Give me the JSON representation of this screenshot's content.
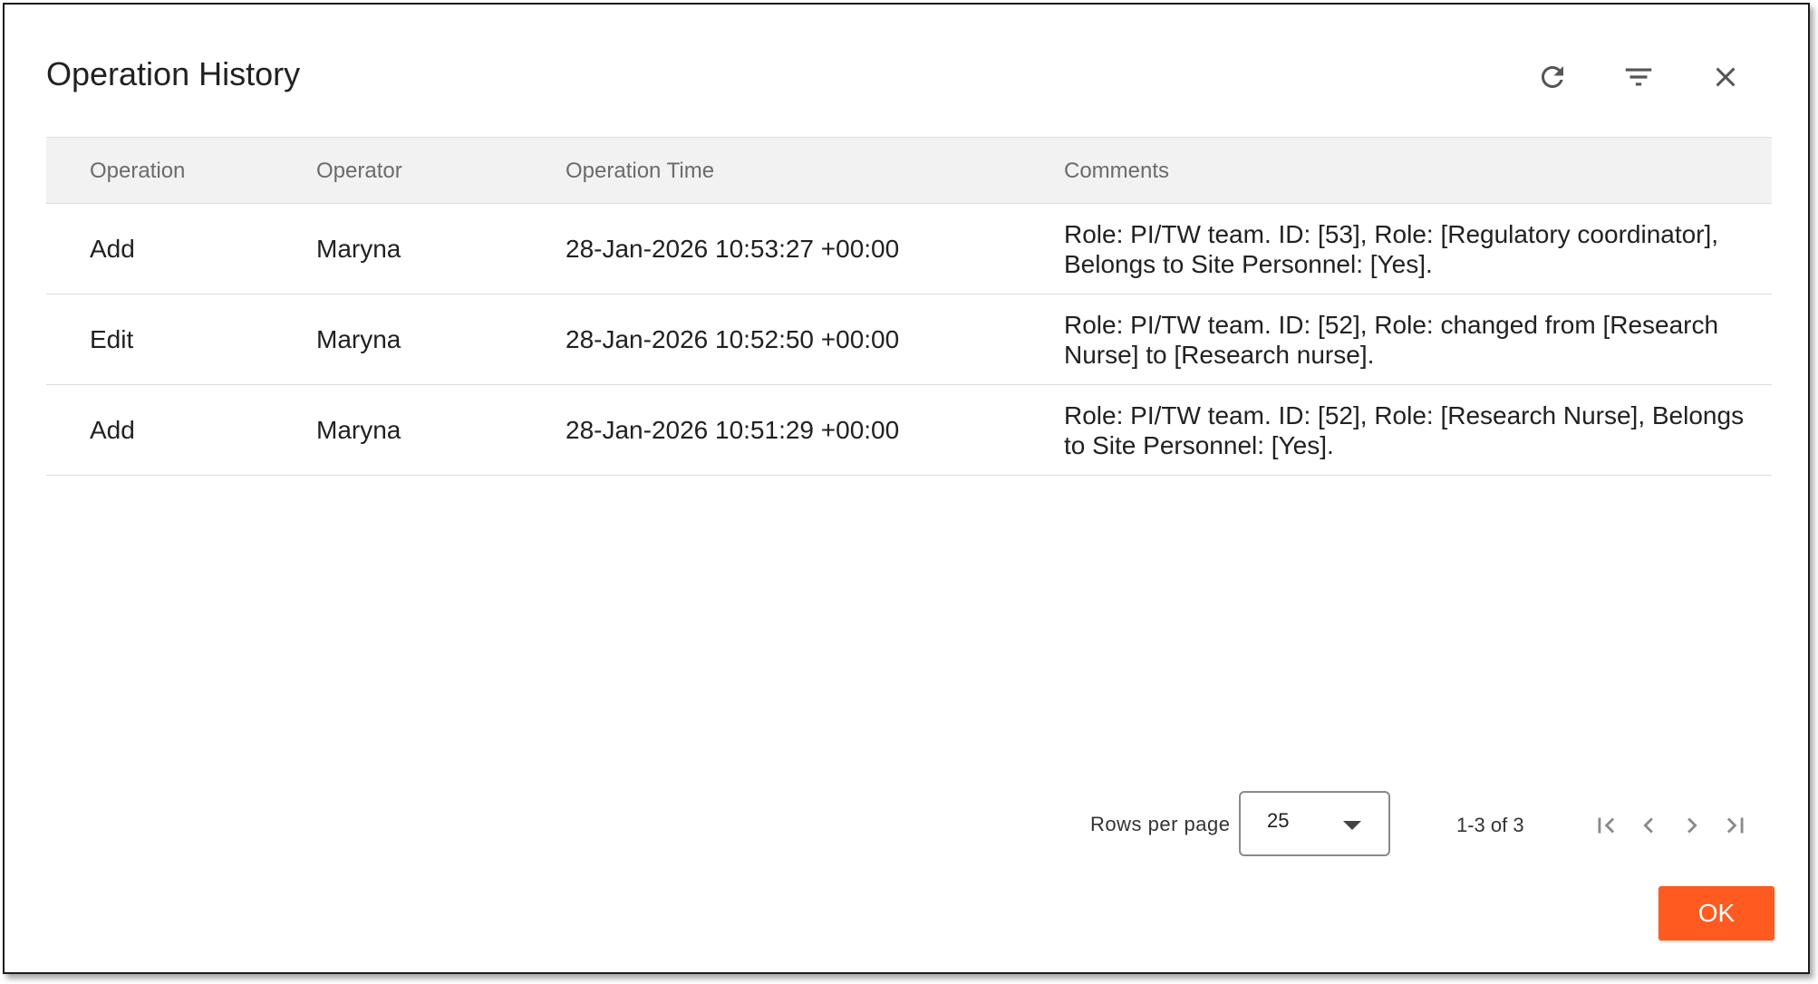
{
  "dialog": {
    "title": "Operation History",
    "icons": {
      "refresh": "refresh-icon",
      "filter": "filter-icon",
      "close": "close-icon"
    }
  },
  "table": {
    "columns": [
      "Operation",
      "Operator",
      "Operation Time",
      "Comments"
    ],
    "rows": [
      {
        "operation": "Add",
        "operator": "Maryna",
        "time": "28-Jan-2026 10:53:27 +00:00",
        "comments": "Role: PI/TW team. ID: [53], Role: [Regulatory coordinator], Belongs to Site Personnel: [Yes]."
      },
      {
        "operation": "Edit",
        "operator": "Maryna",
        "time": "28-Jan-2026 10:52:50 +00:00",
        "comments": "Role: PI/TW team. ID: [52], Role: changed from [Research Nurse] to [Research nurse]."
      },
      {
        "operation": "Add",
        "operator": "Maryna",
        "time": "28-Jan-2026 10:51:29 +00:00",
        "comments": "Role: PI/TW team. ID: [52], Role: [Research Nurse], Belongs to Site Personnel: [Yes]."
      }
    ]
  },
  "pagination": {
    "rows_per_page_label": "Rows per page",
    "rows_per_page_value": "25",
    "range_label": "1-3 of 3"
  },
  "footer": {
    "ok_label": "OK"
  },
  "colors": {
    "accent": "#ff5a1f",
    "header_bg": "#f2f2f2"
  }
}
